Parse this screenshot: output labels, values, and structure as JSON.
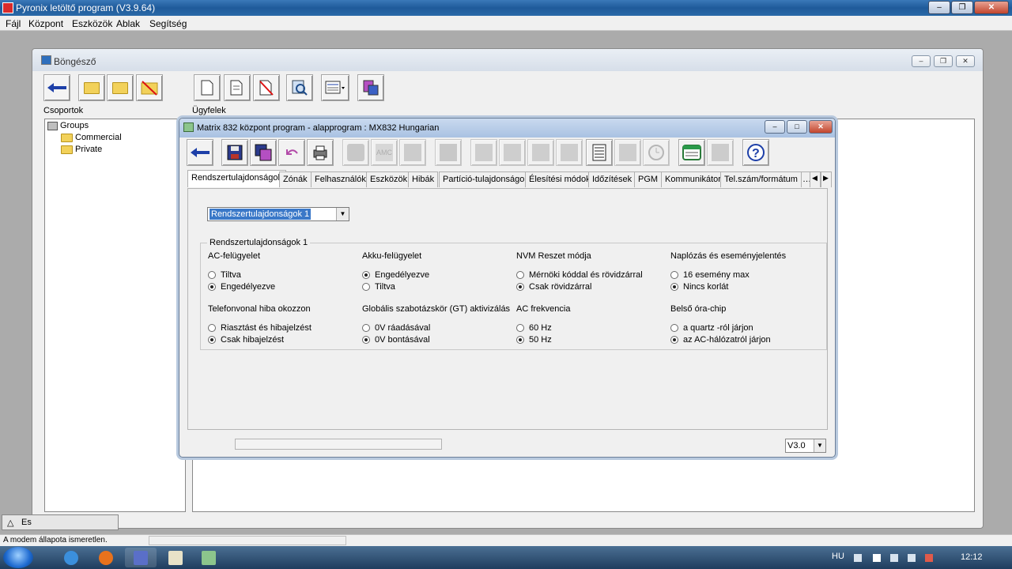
{
  "app": {
    "title": "Pyronix letöltő program (V3.9.64)"
  },
  "menu": [
    "Fájl",
    "Központ",
    "Eszközök",
    "Ablak",
    "Segítség"
  ],
  "browser": {
    "title": "Böngésző",
    "groups_label": "Csoportok",
    "clients_label": "Ügyfelek",
    "tree": [
      "Groups",
      "Commercial",
      "Private"
    ],
    "bottom_tab": "Es"
  },
  "matrix": {
    "title": "Matrix 832 központ program - alapprogram : MX832 Hungarian",
    "tabs": [
      "Rendszertulajdonságok",
      "Zónák",
      "Felhasználók",
      "Eszközök",
      "Hibák",
      "Partíció-tulajdonságok",
      "Élesítési módok",
      "Időzítések",
      "PGM",
      "Kommunikátor",
      "Tel.szám/formátum"
    ],
    "active_tab": "Rendszertulajdonságok",
    "combo_value": "Rendszertulajdonságok 1",
    "group_title": "Rendszertulajdonságok 1",
    "settings": [
      {
        "heading": "AC-felügyelet",
        "options": [
          "Tiltva",
          "Engedélyezve"
        ],
        "selected": 1
      },
      {
        "heading": "Akku-felügyelet",
        "options": [
          "Engedélyezve",
          "Tiltva"
        ],
        "selected": 0
      },
      {
        "heading": "NVM Reszet módja",
        "options": [
          "Mérnöki kóddal és rövidzárral",
          "Csak rövidzárral"
        ],
        "selected": 1
      },
      {
        "heading": "Naplózás és eseményjelentés",
        "options": [
          "16 esemény max",
          "Nincs korlát"
        ],
        "selected": 1
      },
      {
        "heading": "Telefonvonal hiba okozzon",
        "options": [
          "Riasztást és hibajelzést",
          "Csak hibajelzést"
        ],
        "selected": 1
      },
      {
        "heading": "Globális szabotázskör (GT) aktivizálás",
        "options": [
          "0V ráadásával",
          "0V bontásával"
        ],
        "selected": 1
      },
      {
        "heading": "AC frekvencia",
        "options": [
          "60 Hz",
          "50 Hz"
        ],
        "selected": 1
      },
      {
        "heading": "Belső óra-chip",
        "options": [
          "a quartz -ról járjon",
          "az AC-hálózatról járjon"
        ],
        "selected": 1
      }
    ],
    "version": "V3.0"
  },
  "statusbar": {
    "text": "A modem állapota ismeretlen."
  },
  "taskbar": {
    "language": "HU",
    "clock": "12:12"
  }
}
